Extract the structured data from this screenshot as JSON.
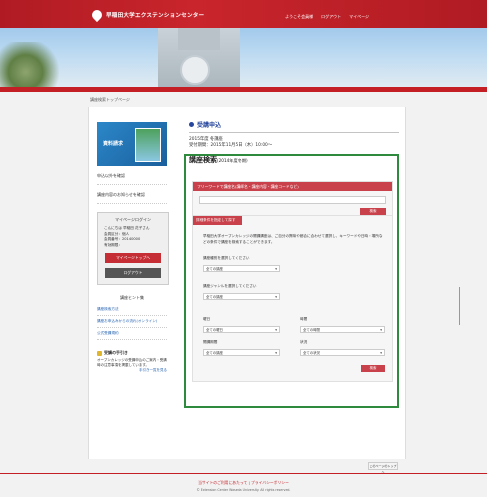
{
  "header": {
    "brand": "早稲田大学エクステンションセンター",
    "links": [
      "ようこそ会員様",
      "ログアウト",
      "マイページ"
    ]
  },
  "breadcrumb": "講座検索トップページ",
  "sidebar": {
    "banner_label": "資料請求",
    "links": [
      "申込以外を確認",
      "講座内容のお知らせを確認"
    ],
    "login": {
      "title": "マイページログイン",
      "lines": [
        "こんにちは 早稲田 花子さん",
        "会員区分：個人",
        "会員番号：20140000",
        "有効期限："
      ],
      "mypage_button": "マイページトップへ",
      "logout_button": "ログアウト"
    },
    "info": {
      "title": "講座ヒント集",
      "links": [
        "講座検索方法",
        "講座お申込みからの流れ(オンライン)",
        "公式受講規約"
      ]
    },
    "category": {
      "title": "受講の手引き",
      "desc": "オープンカレッジの受講申込のご案内・受講時の注意事項を掲載しています。",
      "link": "手引き一覧を見る"
    }
  },
  "main": {
    "heading": "受講申込",
    "sub1": "2015年度 冬講座",
    "sub2": "受付期間：2015年11月5日（木）10:00〜",
    "search_title": "講座検索",
    "search_sub": "(2014年度冬期)",
    "keyword_bar": "フリーワードで講座名(講師名・講座内容・講座コードなど)",
    "search_small": "検索",
    "detail_bar": "詳細条件を指定して探す",
    "detail_desc": "早稲田大学オープンカレッジの開講講座は、ご自分の興味や都合に合わせて選択し、キーワードや日時・場所などの条件で講座を検索することができます。",
    "label_category": "講座種別を選択してください",
    "select_all_1": "全ての講座",
    "label_campus": "講座ジャンルを選択してください",
    "select_all_2": "全ての講座",
    "label_day": "曜日",
    "select_day": "全ての曜日",
    "label_time": "時間",
    "select_time": "全ての時間",
    "label_period": "開講期間",
    "select_period": "全ての講座",
    "label_status": "状況",
    "select_status": "全ての状況",
    "search_button": "検索"
  },
  "pagetop": "このページのトップへ",
  "footer": {
    "line1": "当サイトのご利用にあたって | プライバシーポリシー",
    "line2": "© Extension Center Waseda University. All rights reserved."
  }
}
